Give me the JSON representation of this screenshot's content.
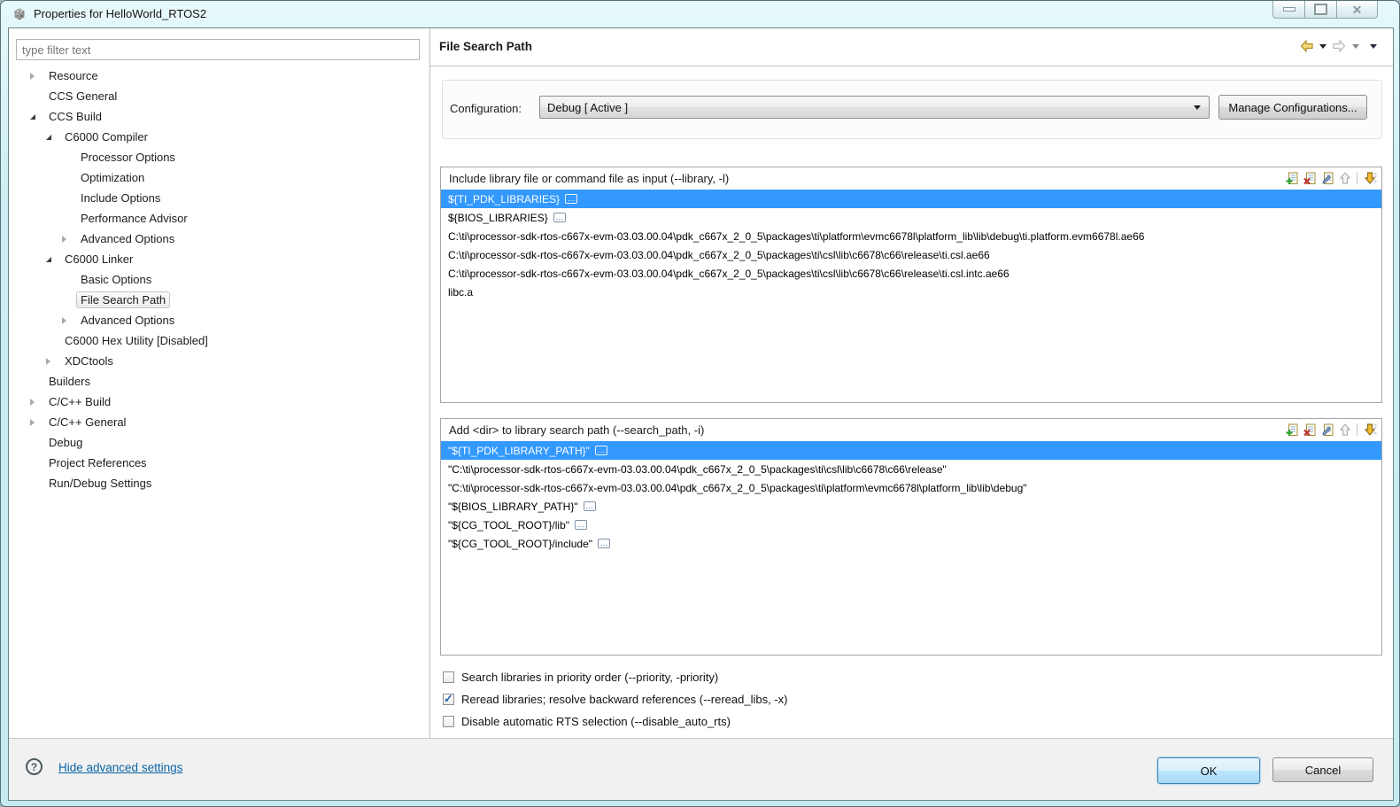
{
  "window": {
    "title": "Properties for HelloWorld_RTOS2"
  },
  "sidebar": {
    "filter_placeholder": "type filter text",
    "tree": [
      {
        "label": "Resource",
        "level": 0,
        "arrow": "collapsed"
      },
      {
        "label": "CCS General",
        "level": 0,
        "arrow": "none"
      },
      {
        "label": "CCS Build",
        "level": 0,
        "arrow": "expanded"
      },
      {
        "label": "C6000 Compiler",
        "level": 1,
        "arrow": "expanded"
      },
      {
        "label": "Processor Options",
        "level": 2,
        "arrow": "none"
      },
      {
        "label": "Optimization",
        "level": 2,
        "arrow": "none"
      },
      {
        "label": "Include Options",
        "level": 2,
        "arrow": "none"
      },
      {
        "label": "Performance Advisor",
        "level": 2,
        "arrow": "none"
      },
      {
        "label": "Advanced Options",
        "level": 2,
        "arrow": "collapsed"
      },
      {
        "label": "C6000 Linker",
        "level": 1,
        "arrow": "expanded"
      },
      {
        "label": "Basic Options",
        "level": 2,
        "arrow": "none"
      },
      {
        "label": "File Search Path",
        "level": 2,
        "arrow": "none",
        "selected": true
      },
      {
        "label": "Advanced Options",
        "level": 2,
        "arrow": "collapsed"
      },
      {
        "label": "C6000 Hex Utility  [Disabled]",
        "level": 1,
        "arrow": "none"
      },
      {
        "label": "XDCtools",
        "level": 1,
        "arrow": "collapsed"
      },
      {
        "label": "Builders",
        "level": 0,
        "arrow": "none"
      },
      {
        "label": "C/C++ Build",
        "level": 0,
        "arrow": "collapsed"
      },
      {
        "label": "C/C++ General",
        "level": 0,
        "arrow": "collapsed"
      },
      {
        "label": "Debug",
        "level": 0,
        "arrow": "none"
      },
      {
        "label": "Project References",
        "level": 0,
        "arrow": "none"
      },
      {
        "label": "Run/Debug Settings",
        "level": 0,
        "arrow": "none"
      }
    ]
  },
  "header": {
    "title": "File Search Path"
  },
  "configuration": {
    "label": "Configuration:",
    "value": "Debug  [ Active ]",
    "manage_button": "Manage Configurations..."
  },
  "groups": [
    {
      "title": "Include library file or command file as input (--library, -l)",
      "items": [
        {
          "text": "${TI_PDK_LIBRARIES}",
          "variable": true,
          "selected": true
        },
        {
          "text": "${BIOS_LIBRARIES}",
          "variable": true
        },
        {
          "text": "C:\\ti\\processor-sdk-rtos-c667x-evm-03.03.00.04\\pdk_c667x_2_0_5\\packages\\ti\\platform\\evmc6678l\\platform_lib\\lib\\debug\\ti.platform.evm6678l.ae66"
        },
        {
          "text": "C:\\ti\\processor-sdk-rtos-c667x-evm-03.03.00.04\\pdk_c667x_2_0_5\\packages\\ti\\csl\\lib\\c6678\\c66\\release\\ti.csl.ae66"
        },
        {
          "text": "C:\\ti\\processor-sdk-rtos-c667x-evm-03.03.00.04\\pdk_c667x_2_0_5\\packages\\ti\\csl\\lib\\c6678\\c66\\release\\ti.csl.intc.ae66"
        },
        {
          "text": "libc.a"
        }
      ]
    },
    {
      "title": "Add <dir> to library search path (--search_path, -i)",
      "items": [
        {
          "text": "\"${TI_PDK_LIBRARY_PATH}\"",
          "variable": true,
          "selected": true
        },
        {
          "text": "\"C:\\ti\\processor-sdk-rtos-c667x-evm-03.03.00.04\\pdk_c667x_2_0_5\\packages\\ti\\csl\\lib\\c6678\\c66\\release\""
        },
        {
          "text": "\"C:\\ti\\processor-sdk-rtos-c667x-evm-03.03.00.04\\pdk_c667x_2_0_5\\packages\\ti\\platform\\evmc6678l\\platform_lib\\lib\\debug\""
        },
        {
          "text": "\"${BIOS_LIBRARY_PATH}\"",
          "variable": true
        },
        {
          "text": "\"${CG_TOOL_ROOT}/lib\"",
          "variable": true
        },
        {
          "text": "\"${CG_TOOL_ROOT}/include\"",
          "variable": true
        }
      ]
    }
  ],
  "toolbar_icons": [
    {
      "name": "add-file-icon"
    },
    {
      "name": "remove-file-icon"
    },
    {
      "name": "edit-file-icon"
    },
    {
      "name": "move-up-icon",
      "disabled": true
    },
    {
      "name": "separator"
    },
    {
      "name": "move-down-icon"
    }
  ],
  "checkboxes": [
    {
      "label": "Search libraries in priority order (--priority, -priority)",
      "checked": false
    },
    {
      "label": "Reread libraries; resolve backward references (--reread_libs, -x)",
      "checked": true
    },
    {
      "label": "Disable automatic RTS selection (--disable_auto_rts)",
      "checked": false
    }
  ],
  "footer": {
    "help_glyph": "?",
    "help_link": "Hide advanced settings",
    "ok": "OK",
    "cancel": "Cancel"
  },
  "icons": {
    "variable_badge": "…",
    "close_glyph": "✕"
  },
  "colors": {
    "selection": "#3399ff",
    "link": "#0a64a4",
    "titlebar": "#cdeef2",
    "footer_bg": "#f1f1f1",
    "back_arrow": "#f0c040"
  }
}
